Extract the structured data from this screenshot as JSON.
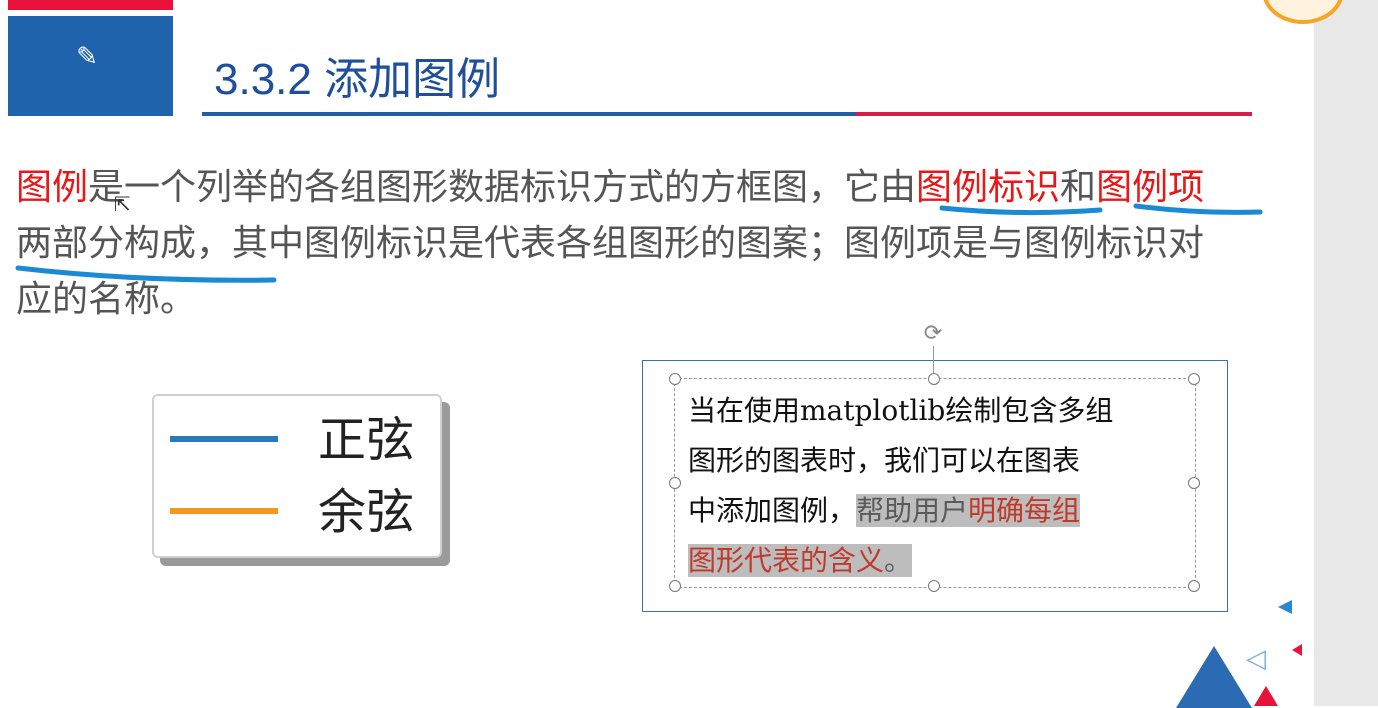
{
  "slide": {
    "heading": "3.3.2 添加图例",
    "pencil_icon": "✎",
    "colors": {
      "brand_blue": "#1f63ad",
      "brand_red": "#e8133a",
      "highlight_red": "#e81818"
    }
  },
  "paragraph": {
    "line1": {
      "term": "图例",
      "text_a": "是一个列举的各组图形数据标识方式的方框图，它由",
      "term2": "图例标识",
      "text_b": "和",
      "term3": "图例项"
    },
    "line2": "两部分构成，其中图例标识是代表各组图形的图案；图例项是与图例标识对",
    "line3": "应的名称。"
  },
  "legend": {
    "items": [
      {
        "label": "正弦",
        "color": "#2a7ab9"
      },
      {
        "label": "余弦",
        "color": "#f5961e"
      }
    ]
  },
  "textbox": {
    "line1": "当在使用matplotlib绘制包含多组",
    "line2": "图形的图表时，我们可以在图表",
    "line3_plain": "中添加图例，",
    "line3_hl": "帮助用户",
    "line3_hl_red": "明确每组",
    "line4_hl_red": "图形代表的含义",
    "line4_hl": "。",
    "rotate_icon": "⟳"
  },
  "decor": {
    "outline_triangle": "◁",
    "cursor": "⇱"
  }
}
